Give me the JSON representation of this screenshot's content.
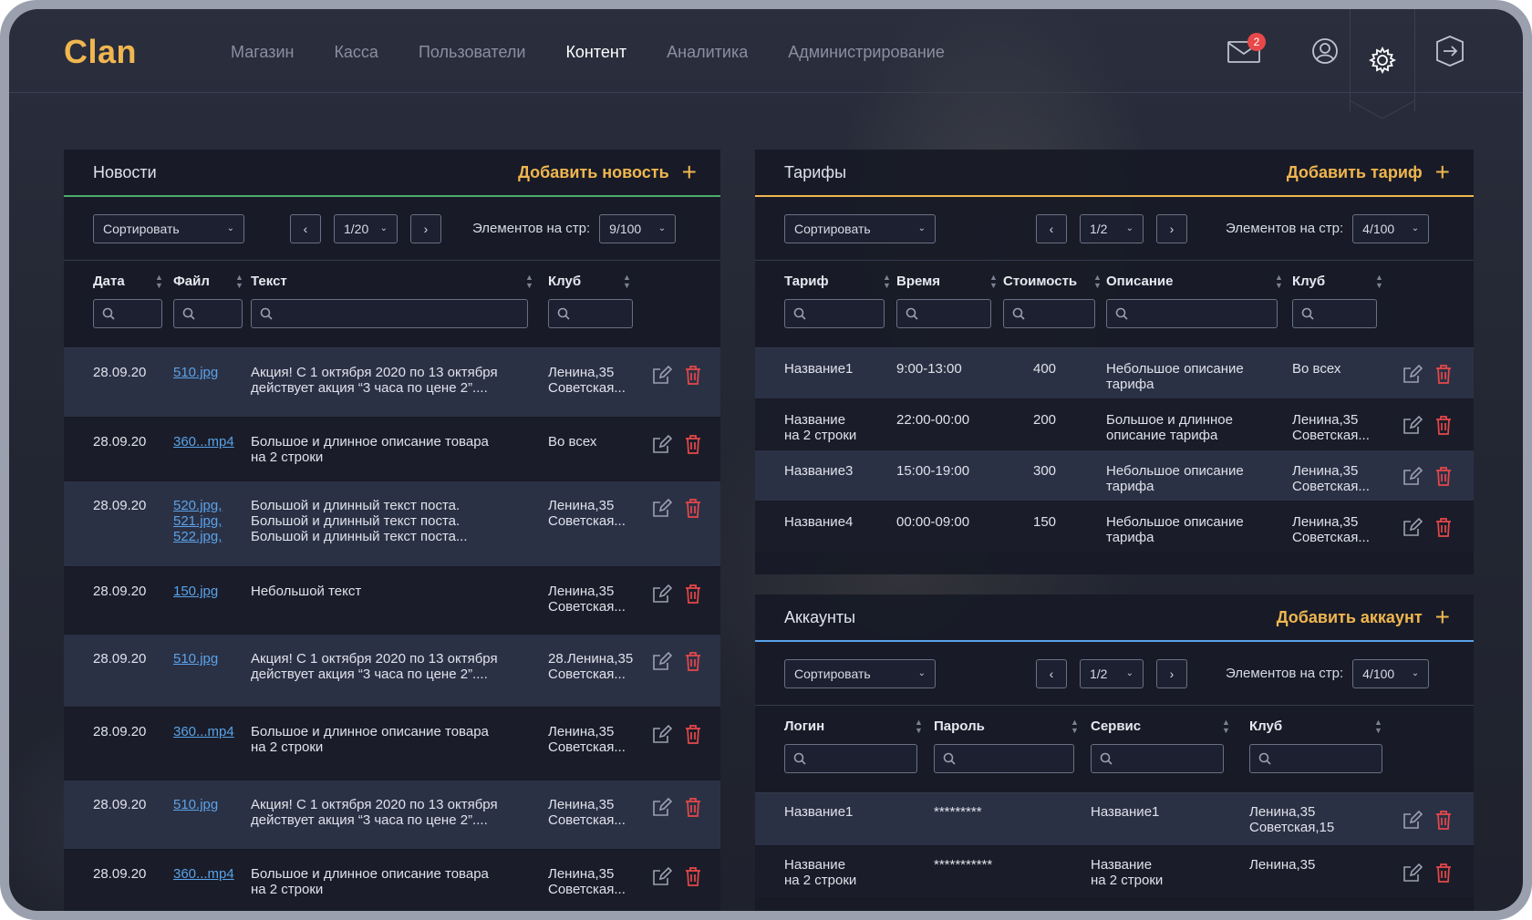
{
  "header": {
    "logo": "Clan",
    "nav": [
      "Магазин",
      "Касса",
      "Пользователи",
      "Контент",
      "Аналитика",
      "Администрирование"
    ],
    "active_nav": "Контент",
    "mail_badge": "2"
  },
  "news": {
    "title": "Новости",
    "add_label": "Добавить новость",
    "sort_label": "Сортировать",
    "page": "1/20",
    "per_page_label": "Элементов на стр:",
    "per_page": "9/100",
    "columns": [
      "Дата",
      "Файл",
      "Текст",
      "Клуб"
    ],
    "rows": [
      {
        "date": "28.09.20",
        "files": [
          "510.jpg"
        ],
        "text": [
          "Акция! С 1 октября 2020 по 13 октября",
          "действует акция “3 часа по цене 2”...."
        ],
        "club": [
          "Ленина,35",
          "Советская..."
        ]
      },
      {
        "date": "28.09.20",
        "files": [
          "360...mp4"
        ],
        "text": [
          "Большое и длинное описание товара",
          "на 2 строки"
        ],
        "club": [
          "Во всех",
          ""
        ]
      },
      {
        "date": "28.09.20",
        "files": [
          "520.jpg,",
          "521.jpg,",
          "522.jpg,"
        ],
        "text": [
          "Большой и длинный текст поста.",
          "Большой и длинный текст поста.",
          "Большой и длинный текст поста..."
        ],
        "club": [
          "Ленина,35",
          "Советская..."
        ]
      },
      {
        "date": "28.09.20",
        "files": [
          "150.jpg"
        ],
        "text": [
          "Небольшой текст",
          ""
        ],
        "club": [
          "Ленина,35",
          "Советская..."
        ]
      },
      {
        "date": "28.09.20",
        "files": [
          "510.jpg"
        ],
        "text": [
          "Акция! С 1 октября 2020 по 13 октября",
          "действует акция “3 часа по цене 2”...."
        ],
        "club": [
          "28.Ленина,35",
          "Советская..."
        ]
      },
      {
        "date": "28.09.20",
        "files": [
          "360...mp4"
        ],
        "text": [
          "Большое и длинное описание товара",
          "на 2 строки"
        ],
        "club": [
          "Ленина,35",
          "Советская..."
        ]
      },
      {
        "date": "28.09.20",
        "files": [
          "510.jpg"
        ],
        "text": [
          "Акция! С 1 октября 2020 по 13 октября",
          "действует акция “3 часа по цене 2”...."
        ],
        "club": [
          "Ленина,35",
          "Советская..."
        ]
      },
      {
        "date": "28.09.20",
        "files": [
          "360...mp4"
        ],
        "text": [
          "Большое и длинное описание товара",
          "на 2 строки"
        ],
        "club": [
          "Ленина,35",
          "Советская..."
        ]
      }
    ]
  },
  "tariffs": {
    "title": "Тарифы",
    "add_label": "Добавить тариф",
    "sort_label": "Сортировать",
    "page": "1/2",
    "per_page_label": "Элементов на стр:",
    "per_page": "4/100",
    "columns": [
      "Тариф",
      "Время",
      "Стоимость",
      "Описание",
      "Клуб"
    ],
    "rows": [
      {
        "name": [
          "Название1",
          ""
        ],
        "time": "9:00-13:00",
        "price": "400",
        "desc": [
          "Небольшое описание",
          "тарифа"
        ],
        "club": [
          "Во всех",
          ""
        ]
      },
      {
        "name": [
          "Название",
          "на 2 строки"
        ],
        "time": "22:00-00:00",
        "price": "200",
        "desc": [
          "Большое и длинное",
          "описание тарифа"
        ],
        "club": [
          "Ленина,35",
          "Советская..."
        ]
      },
      {
        "name": [
          "Название3",
          ""
        ],
        "time": "15:00-19:00",
        "price": "300",
        "desc": [
          "Небольшое описание",
          "тарифа"
        ],
        "club": [
          "Ленина,35",
          "Советская..."
        ]
      },
      {
        "name": [
          "Название4",
          ""
        ],
        "time": "00:00-09:00",
        "price": "150",
        "desc": [
          "Небольшое описание",
          "тарифа"
        ],
        "club": [
          "Ленина,35",
          "Советская..."
        ]
      }
    ]
  },
  "accounts": {
    "title": "Аккаунты",
    "add_label": "Добавить аккаунт",
    "sort_label": "Сортировать",
    "page": "1/2",
    "per_page_label": "Элементов на стр:",
    "per_page": "4/100",
    "columns": [
      "Логин",
      "Пароль",
      "Сервис",
      "Клуб"
    ],
    "rows": [
      {
        "login": [
          "Название1",
          ""
        ],
        "password": "*********",
        "service": [
          "Название1",
          ""
        ],
        "club": [
          "Ленина,35",
          "Советская,15"
        ]
      },
      {
        "login": [
          "Название",
          "на 2 строки"
        ],
        "password": "***********",
        "service": [
          "Название",
          "на 2 строки"
        ],
        "club": [
          "Ленина,35",
          ""
        ]
      }
    ]
  },
  "colors": {
    "accent": "#f0b64f",
    "news_divider": "#4caa6a",
    "tariffs_divider": "#f0b64f",
    "accounts_divider": "#5aa2e8",
    "link": "#5aa2e8",
    "delete": "#e8484a"
  }
}
